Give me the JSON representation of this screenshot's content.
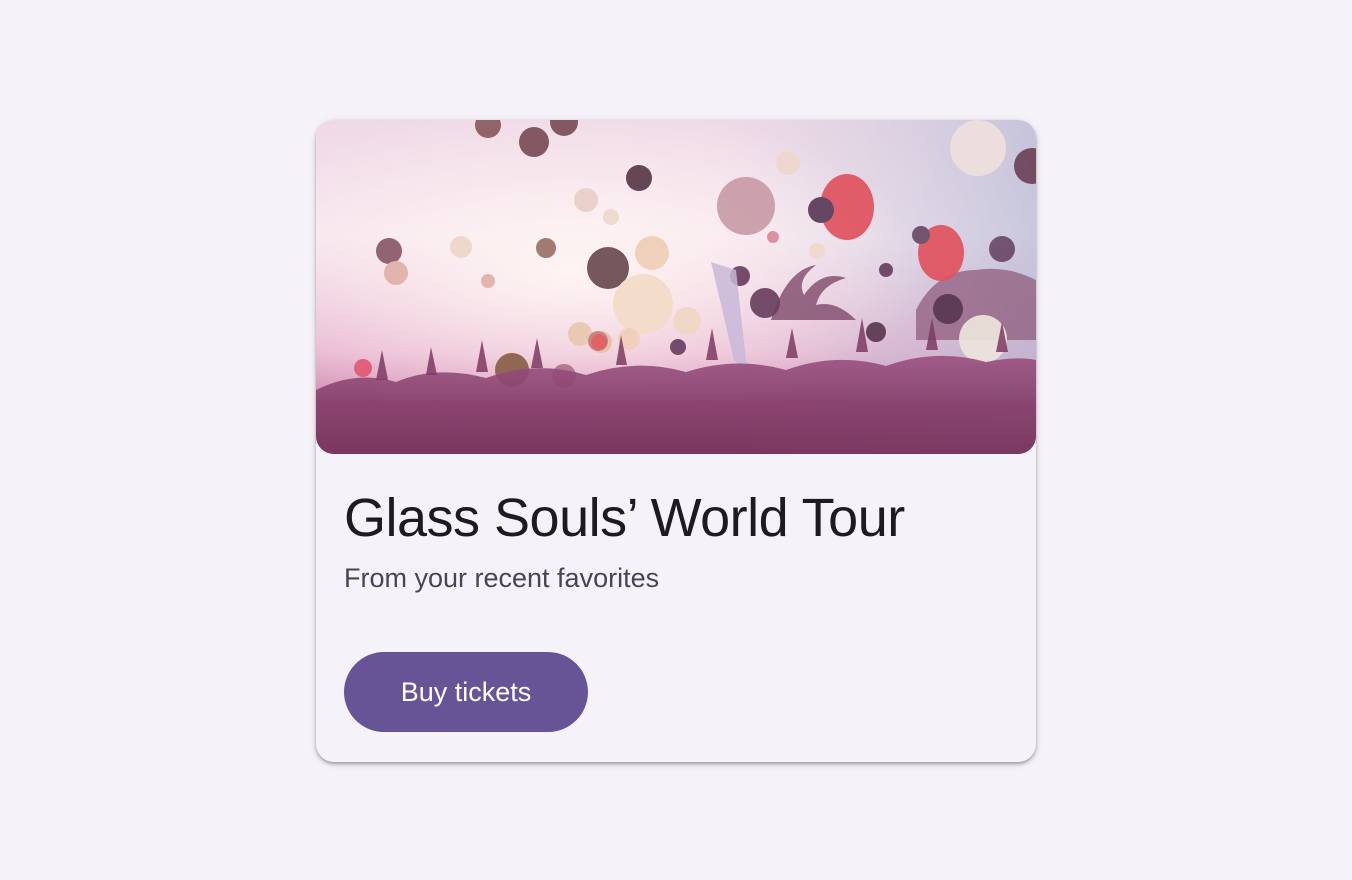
{
  "card": {
    "title": "Glass Souls’ World Tour",
    "subtitle": "From your recent favorites",
    "button_label": "Buy tickets"
  },
  "colors": {
    "background": "#f6f2f9",
    "card_surface": "#f6f2f9",
    "title_text": "#1d1b20",
    "subtitle_text": "#49454f",
    "button_fill": "#675496",
    "button_text": "#ffffff"
  },
  "hero_image": {
    "subject": "concert-crowd-with-balloons"
  }
}
